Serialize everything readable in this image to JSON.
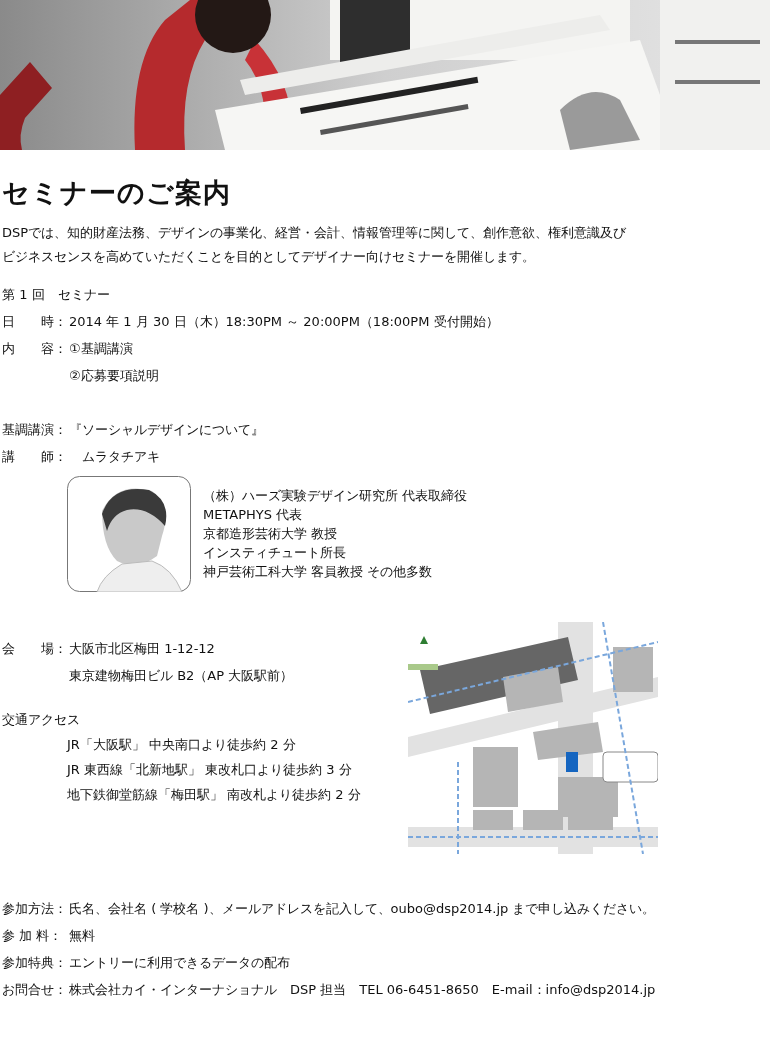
{
  "banner": {
    "kind": "picture"
  },
  "title": "セミナーのご案内",
  "intro_lines": [
    "DSPでは、知的財産法務、デザインの事業化、経営・会計、情報管理等に関して、創作意欲、権利意識及び",
    "ビジネスセンスを高めていただくことを目的としてデザイナー向けセミナーを開催します。"
  ],
  "seminar_heading": "第 1 回　セミナー",
  "schedule": [
    {
      "label": "日　　時：",
      "values": [
        "2014 年 1 月 30 日（木）18:30PM ～ 20:00PM（18:00PM 受付開始）"
      ]
    },
    {
      "label": "内　　容：",
      "values": [
        "①基調講演",
        "②応募要項説明"
      ]
    }
  ],
  "keynote": [
    {
      "label": "基調講演：",
      "values": [
        "『ソーシャルデザインについて』"
      ]
    },
    {
      "label": "講　　師：",
      "values": [
        "　ムラタチアキ"
      ]
    }
  ],
  "speaker": {
    "photo": {
      "kind": "picture"
    },
    "bio": [
      "（株）ハーズ実験デザイン研究所 代表取締役",
      "METAPHYS 代表",
      "京都造形芸術大学 教授",
      "インスティチュート所長",
      "神戸芸術工科大学 客員教授 その他多数"
    ]
  },
  "venue": {
    "label": "会　　場：",
    "values": [
      "大阪市北区梅田 1-12-12",
      "東京建物梅田ビル B2（AP 大阪駅前）"
    ]
  },
  "access": {
    "heading": "交通アクセス",
    "lines": [
      "JR「大阪駅」 中央南口より徒歩約 2 分",
      "JR 東西線「北新地駅」 東改札口より徒歩約 3 分",
      "地下鉄御堂筋線「梅田駅」 南改札より徒歩約 2 分"
    ]
  },
  "map": {
    "kind": "picture"
  },
  "footer": [
    {
      "label": "参加方法：",
      "value": "氏名、会社名 ( 学校名 )、メールアドレスを記入して、oubo@dsp2014.jp まで申し込みください。"
    },
    {
      "label": "参 加 料：",
      "value": "無料"
    },
    {
      "label": "参加特典：",
      "value": "エントリーに利用できるデータの配布"
    },
    {
      "label": "お問合せ：",
      "value": "株式会社カイ・インターナショナル　DSP 担当　TEL 06-6451-8650　E-mail：info@dsp2014.jp"
    }
  ]
}
